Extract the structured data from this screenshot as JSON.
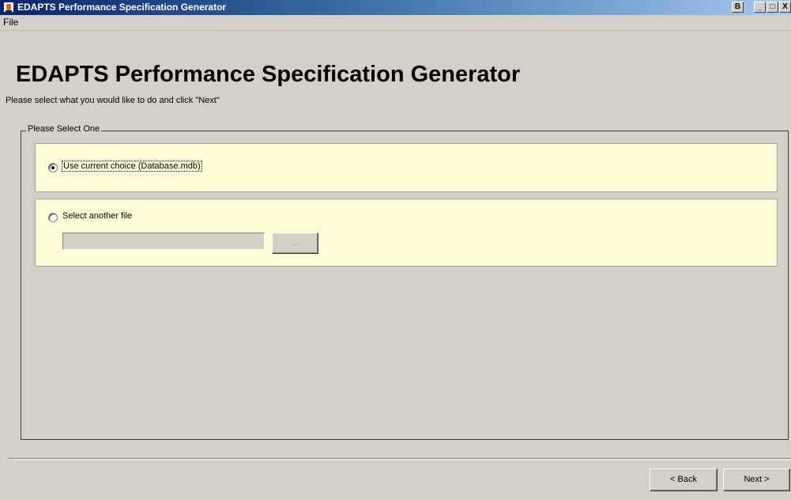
{
  "window": {
    "title": "EDAPTS Performance Specification Generator",
    "app_icon": "java-icon",
    "controls": {
      "restore": "B",
      "minimize": "_",
      "maximize": "□",
      "close": "X"
    }
  },
  "menubar": {
    "items": [
      {
        "label": "File"
      }
    ]
  },
  "header": {
    "title": "EDAPTS Performance Specification Generator",
    "subtitle": "Please select what you would like to do and click \"Next\""
  },
  "selection": {
    "group_label": "Please Select One",
    "options": [
      {
        "label": "Use current choice (Database.mdb)",
        "selected": true
      },
      {
        "label": "Select another file",
        "selected": false
      }
    ],
    "file_path": {
      "value": "",
      "placeholder": ""
    },
    "browse_label": "..."
  },
  "footer": {
    "back_label": "< Back",
    "next_label": "Next >"
  },
  "colors": {
    "panel_background": "#ffffd8",
    "window_background": "#d4d0c8",
    "titlebar_start": "#0a246a",
    "titlebar_end": "#a6caf0"
  }
}
